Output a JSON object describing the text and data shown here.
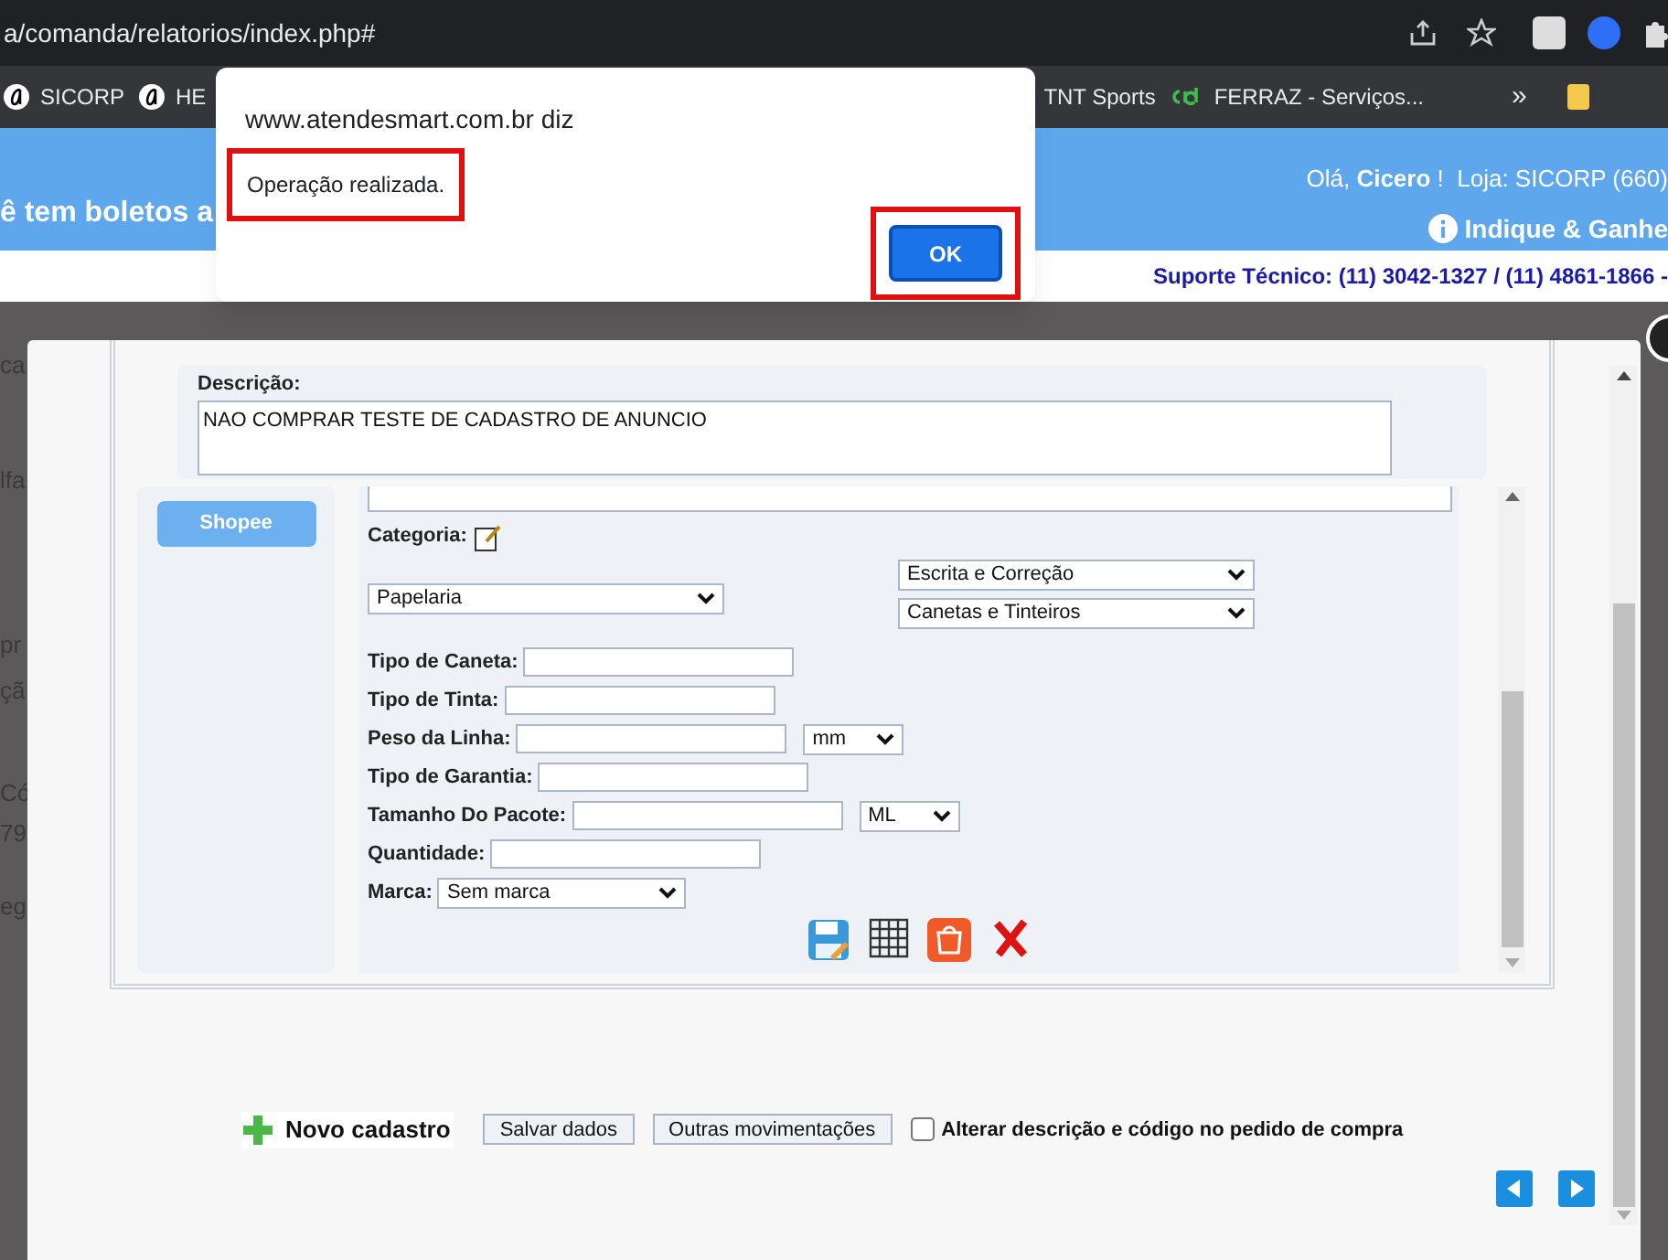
{
  "browser": {
    "url": "a/comanda/relatorios/index.php#",
    "bookmarks": [
      {
        "label": "SICORP",
        "kind": "script-a"
      },
      {
        "label": "HE",
        "kind": "script-a"
      },
      {
        "label": "TNT Sports",
        "kind": "plain"
      },
      {
        "label": "FERRAZ - Serviços...",
        "kind": "cid"
      }
    ],
    "overflow": "»"
  },
  "site_header": {
    "banner": "ê tem boletos a",
    "greeting": "Olá, **Cicero** !  Loja: SICORP (660)",
    "referral": "Indique & Ganhe",
    "support": "Suporte Técnico: (11) 3042-1327 / (11) 4861-1866 -"
  },
  "background_fragments": [
    "ca",
    "lfa",
    "pr",
    "çã",
    "Có",
    "79",
    "eg"
  ],
  "alert": {
    "origin": "www.atendesmart.com.br diz",
    "message": "Operação realizada.",
    "message_highlighted": true,
    "button": "OK",
    "button_highlighted": true
  },
  "modal": {
    "description_label": "Descrição:",
    "description": "NAO COMPRAR TESTE DE CADASTRO DE ANUNCIO",
    "marketplace_button": "Shopee",
    "category_label": "Categoria:",
    "category_selects": [
      {
        "value": "Papelaria"
      },
      {
        "value": "Escrita e Correção"
      },
      {
        "value": "Canetas e Tinteiros"
      }
    ],
    "fields": [
      {
        "label": "Tipo de Caneta:",
        "kind": "text"
      },
      {
        "label": "Tipo de Tinta:",
        "kind": "text"
      },
      {
        "label": "Peso da Linha:",
        "kind": "unit",
        "unit": "mm"
      },
      {
        "label": "Tipo de Garantia:",
        "kind": "text"
      },
      {
        "label": "Tamanho Do Pacote:",
        "kind": "unit",
        "unit": "ML"
      },
      {
        "label": "Quantidade:",
        "kind": "text"
      },
      {
        "label": "Marca:",
        "kind": "select",
        "value": "Sem marca"
      }
    ]
  },
  "footer": {
    "new_record": "Novo cadastro",
    "buttons": [
      "Salvar dados",
      "Outras movimentações"
    ],
    "checkbox": {
      "label": "Alterar descrição e código no pedido de compra",
      "checked": false
    }
  }
}
